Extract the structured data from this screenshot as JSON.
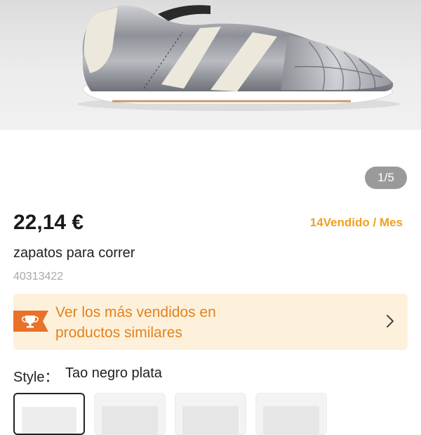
{
  "gallery": {
    "page_indicator": "1/5"
  },
  "product": {
    "price": "22,14 €",
    "sold": "14Vendido / Mes",
    "title": "zapatos para correr",
    "sku": "40313422"
  },
  "banner": {
    "line1": "Ver los más vendidos en",
    "line2": "productos similares",
    "icon": "trophy-icon",
    "arrow_icon": "chevron-right-icon"
  },
  "style": {
    "label": "Style：",
    "value": "Tao negro plata"
  },
  "colors": {
    "accent": "#f0a020",
    "banner_bg": "#fdf1dc",
    "banner_text": "#e2821e",
    "tag": "#e8722a"
  }
}
